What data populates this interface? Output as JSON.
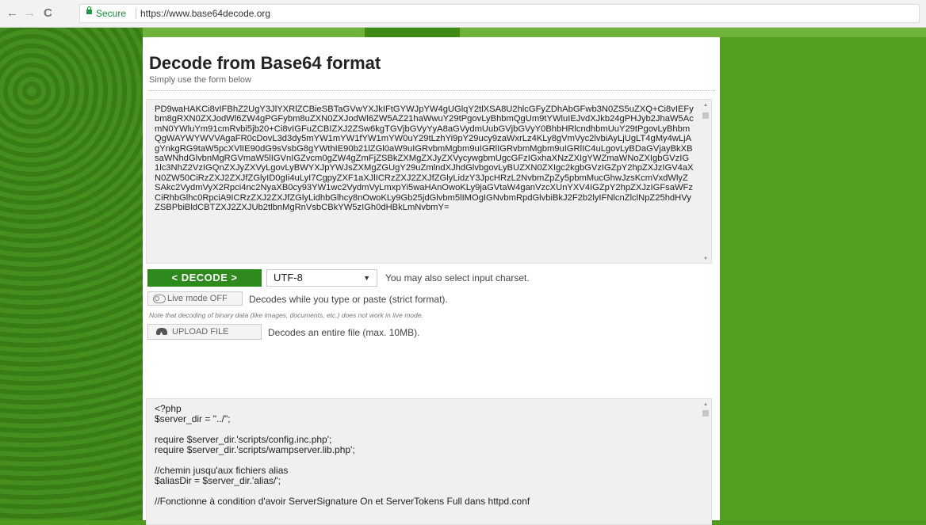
{
  "browser": {
    "back": "←",
    "forward": "→",
    "reload": "C",
    "secure_label": "Secure",
    "url": "https://www.base64decode.org"
  },
  "page": {
    "title": "Decode from Base64 format",
    "subtitle": "Simply use the form below",
    "base64_input": "PD9waHAKCi8vIFBhZ2UgY3JlYXRlZCBieSBTaGVwYXJkIFtGYWJpYW4gUGlqY2tlXSA8U2hlcGFyZDhAbGFwb3N0ZS5uZXQ+Ci8vIEFybm8gRXN0ZXJodWl6ZW4gPGFybm8uZXN0ZXJodWl6ZW5AZ21haWwuY29tPgovLyBhbmQgUm9tYWluIEJvdXJkb24gPHJyb2JhaW5AcmN0YWluYm91cmRvbi5jb20+Ci8vIGFuZCBIZXJ2ZSw6kgTGVjbGVyYyA8aGVydmUubGVjbGVyY0BhbHRlcndhbmUuY29tPgovLyBhbmQgWAYWYWVVAgaFR0cDovL3d3dy5mYW1mYW1fYW1mYW0uY29tLzhYi9pY29ucy9zaWxrLz4KLy8gVmVyc2lvbiAyLjUgLT4gMy4wLjAgYnkgRG9taW5pcXVlIE90dG9sVsbG8gYWthIE90b21lZGl0aW9uIGRvbmMgbm9uIGRlIGRvbmMgbm9uIGRlIC4uLgovLyBDaGVjayBkXBsaWNhdGlvbnMgRGVmaW5lIGVnIGZvcm0gZW4gZmFjZSBkZXMgZXJyZXVycywgbmUgcGFzIGxhaXNzZXIgYWZmaWNoZXIgbGVzIG1lc3NhZ2VzIGQnZXJyZXVyLgovLyBWYXJpYWJsZXMgZGUgY29uZmlndXJhdGlvbgovLyBUZXN0ZXIgc2kgbGVzIGZpY2hpZXJzIGV4aXN0ZW50CiRzZXJ2ZXJfZGlyID0gIi4uLyI7CgpyZXF1aXJlICRzZXJ2ZXJfZGlyLidzY3JpcHRzL2NvbmZpZy5pbmMucGhwJzsKcmVxdWlyZSAkc2VydmVyX2Rpci4nc2NyaXB0cy93YW1wc2VydmVyLmxpYi5waHAnOwoKLy9jaGVtaW4ganVzcXUnYXV4IGZpY2hpZXJzIGFsaWFzCiRhbGlhc0RpciA9ICRzZXJ2ZXJfZGlyLidhbGlhcy8nOwoKLy9Gb25jdGlvbm5lIMOgIGNvbmRpdGlvbiBkJ2F2b2lyIFNlcnZlclNpZ25hdHVyZSBPbiBldCBTZXJ2ZXJUb2tlbnMgRnVsbCBkYW5zIGh0dHBkLmNvbmY=",
    "decode_button": "< DECODE >",
    "charset_value": "UTF-8",
    "charset_hint": "You may also select input charset.",
    "live_mode_button": "Live mode OFF",
    "live_mode_hint": "Decodes while you type or paste (strict format).",
    "live_note": "Note that decoding of binary data (like images, documents, etc.) does not work in live mode.",
    "upload_button": "UPLOAD FILE",
    "upload_hint": "Decodes an entire file (max. 10MB).",
    "output_lines": [
      "<?php",
      "$server_dir = \"../\";",
      "",
      "require $server_dir.'scripts/config.inc.php';",
      "require $server_dir.'scripts/wampserver.lib.php';",
      "",
      "//chemin jusqu'aux fichiers alias",
      "$aliasDir = $server_dir.'alias/';",
      "",
      "//Fonctionne à condition d'avoir ServerSignature On et ServerTokens Full dans httpd.conf"
    ]
  },
  "colors": {
    "page_green": "#4e9a1f",
    "button_green": "#2f8a1e",
    "secure_green": "#1a8a3a"
  }
}
